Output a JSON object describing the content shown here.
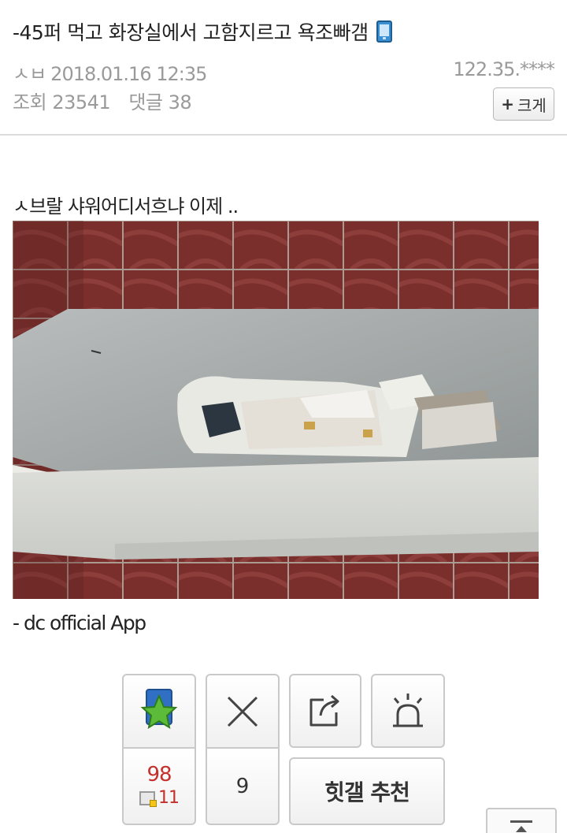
{
  "post": {
    "title": "-45퍼 먹고 화장실에서 고함지르고 욕조빠갬",
    "title_icon": "mobile-phone-icon",
    "nickname": "ㅅㅂ",
    "datetime": "2018.01.16 12:35",
    "ip": "122.35.****",
    "views_label": "조회",
    "views": "23541",
    "comments_label": "댓글",
    "comments": "38",
    "font_button_plus": "+",
    "font_button_label": "크게",
    "body_text": "ㅅ브랄 샤워어디서흐냐 이제 ..",
    "footer_text": "- dc official App"
  },
  "actions": {
    "recommend_icon": "green-star-icon",
    "recommend_count": "98",
    "fix_icon": "fixed-recommend-icon",
    "fix_count": "11",
    "nonrecommend_icon": "x-icon",
    "nonrecommend_count": "9",
    "share_icon": "share-icon",
    "report_icon": "siren-icon",
    "hit_button_label": "힛갤 추천",
    "top_icon": "scroll-top-icon"
  },
  "colors": {
    "count_red": "#c4302b",
    "meta_gray": "#9a9a9a",
    "star_green": "#5dbb3a",
    "star_bg_blue": "#2f6fc4"
  }
}
